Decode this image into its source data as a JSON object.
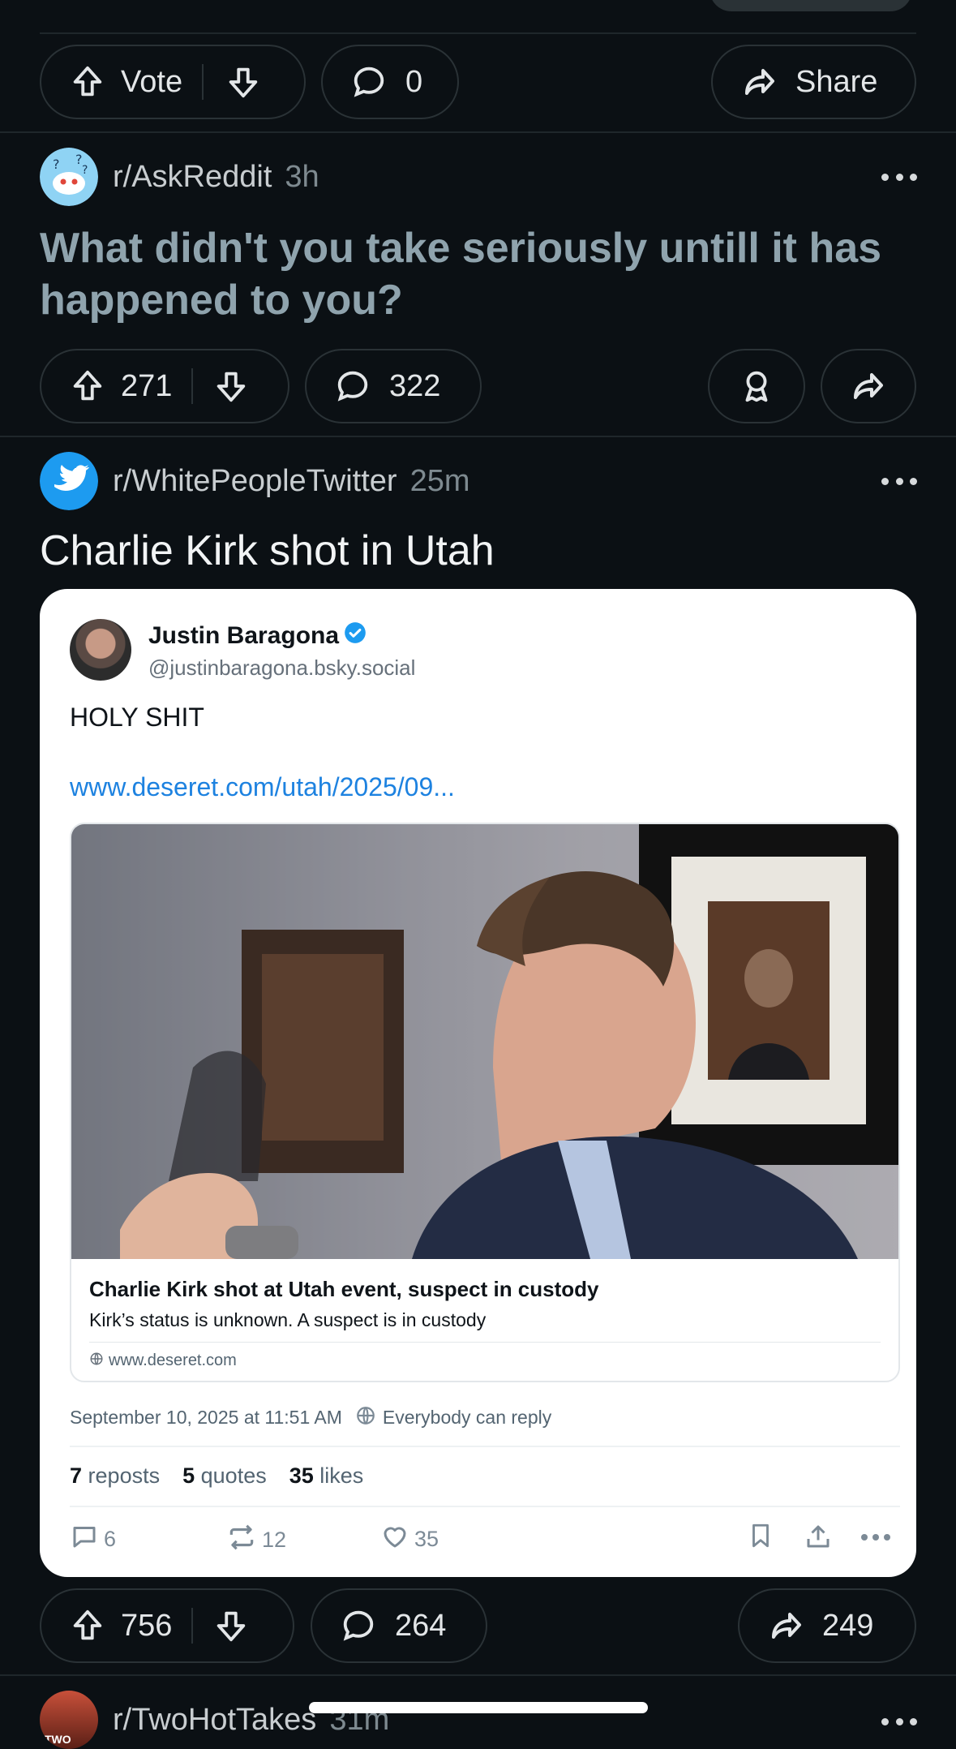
{
  "feed": {
    "post0": {
      "vote_label": "Vote",
      "comments": "0",
      "share_label": "Share"
    },
    "post1": {
      "subreddit": "r/AskReddit",
      "time": "3h",
      "title": "What didn't you take seriously untill it has happened to you?",
      "votes": "271",
      "comments": "322"
    },
    "post2": {
      "subreddit": "r/WhitePeopleTwitter",
      "time": "25m",
      "title": "Charlie Kirk shot in Utah",
      "embed": {
        "author": "Justin Baragona",
        "handle": "@justinbaragona.bsky.social",
        "text": "HOLY SHIT",
        "link": "www.deseret.com/utah/2025/09...",
        "link_card": {
          "headline": "Charlie Kirk shot at Utah event, suspect in custody",
          "description": "Kirk’s status is unknown. A suspect is in custody",
          "domain": "www.deseret.com"
        },
        "timestamp": "September 10, 2025 at 11:51 AM",
        "reply_setting": "Everybody can reply",
        "stats": {
          "reposts_count": "7",
          "reposts_label": "reposts",
          "quotes_count": "5",
          "quotes_label": "quotes",
          "likes_count": "35",
          "likes_label": "likes"
        },
        "actions": {
          "replies": "6",
          "reposts": "12",
          "likes": "35"
        }
      },
      "votes": "756",
      "comments": "264",
      "shares": "249"
    },
    "post3": {
      "subreddit": "r/TwoHotTakes",
      "time": "31m",
      "avatar_text": "TWO"
    }
  },
  "colors": {
    "background": "#0b1014",
    "link_blue": "#1d82e0",
    "verified": "#1d9bf0",
    "read_title": "#8fa3ad"
  }
}
